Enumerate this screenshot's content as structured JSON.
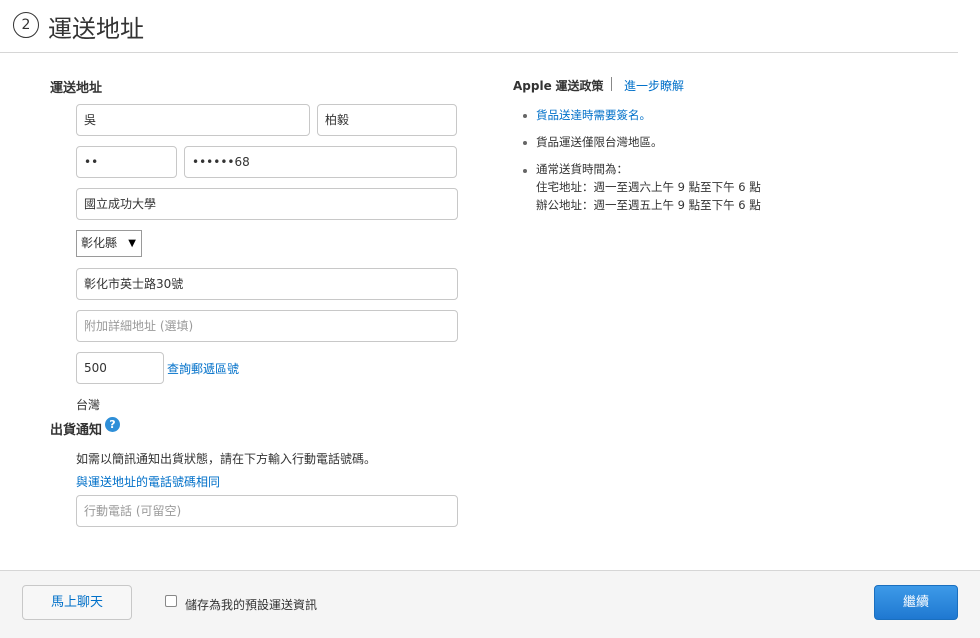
{
  "header": {
    "step_number": "2",
    "title": "運送地址"
  },
  "address_form": {
    "section_label": "運送地址",
    "last_name": "吳",
    "first_name": "柏毅",
    "phone_area": "••",
    "phone_number": "••••••68",
    "company": "國立成功大學",
    "county_select": "彰化縣",
    "street": "彰化市英士路30號",
    "address_line2_placeholder": "附加詳細地址 (選填)",
    "postal_code": "500",
    "postal_lookup_link": "查詢郵遞區號",
    "country": "台灣"
  },
  "notification": {
    "section_label": "出貨通知",
    "help_icon_glyph": "?",
    "description": "如需以簡訊通知出貨狀態，請在下方輸入行動電話號碼。",
    "same_phone_link": "與運送地址的電話號碼相同",
    "mobile_placeholder": "行動電話 (可留空)"
  },
  "policy": {
    "brand": "Apple",
    "title": "運送政策",
    "learn_more_link": "進一步瞭解",
    "items": [
      "貨品送達時需要簽名。",
      "貨品運送僅限台灣地區。",
      "通常送貨時間為：",
      "住宅地址：週一至週六上午 9 點至下午 6 點",
      "辦公地址：週一至週五上午 9 點至下午 6 點"
    ]
  },
  "footer": {
    "chat_button": "馬上聊天",
    "save_default_label": "儲存為我的預設運送資訊",
    "save_default_checked": false,
    "continue_button": "繼續"
  },
  "colors": {
    "link": "#0070c9",
    "primary_button": "#1f78d1",
    "help_icon": "#2f8fd8"
  }
}
